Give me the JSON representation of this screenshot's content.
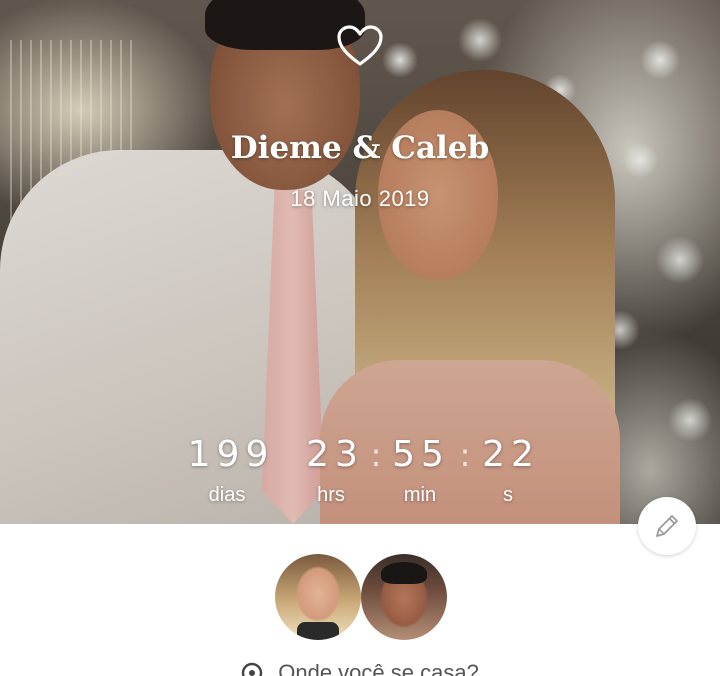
{
  "header": {
    "couple_names": "Dieme & Caleb",
    "date": "18 Maio 2019"
  },
  "countdown": {
    "days": "199",
    "hours": "23",
    "minutes": "55",
    "seconds": "22",
    "separator": ":",
    "days_label": "dias",
    "hours_label": "hrs",
    "minutes_label": "min",
    "seconds_label": "s"
  },
  "actions": {
    "edit_icon": "pencil-icon"
  },
  "location": {
    "icon": "location-pin-icon",
    "text": "Onde você se casa?"
  },
  "colors": {
    "overlay_text": "#ffffff",
    "secondary_text": "#555555",
    "background": "#ffffff"
  }
}
